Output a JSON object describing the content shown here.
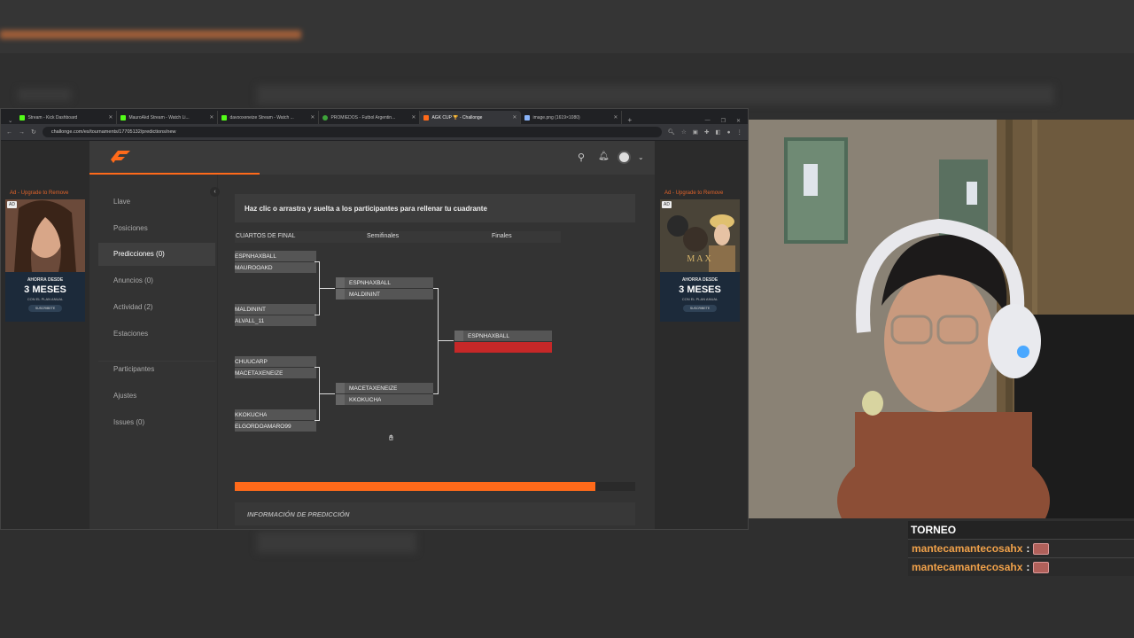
{
  "browser": {
    "tabs": [
      {
        "label": "Stream - Kick Dashboard",
        "color": "#53fc18"
      },
      {
        "label": "MauroAkd Stream - Watch Li...",
        "color": "#53fc18"
      },
      {
        "label": "davooxeneize Stream - Watch ...",
        "color": "#53fc18"
      },
      {
        "label": "PROMIEDOS - Futbol Argentin...",
        "color": "#3ea33a"
      },
      {
        "label": "AGK CUP 🏆 - Challonge",
        "color": "#ff6a1a"
      },
      {
        "label": "image.png (1619×1080)",
        "color": "#8ab4f8"
      }
    ],
    "url": "challonge.com/es/tournaments/17705132/predictions/new"
  },
  "sidebar": {
    "items": [
      {
        "label": "Llave"
      },
      {
        "label": "Posiciones"
      },
      {
        "label": "Predicciones (0)"
      },
      {
        "label": "Anuncios (0)"
      },
      {
        "label": "Actividad (2)"
      },
      {
        "label": "Estaciones"
      },
      {
        "label": "Participantes"
      },
      {
        "label": "Ajustes"
      },
      {
        "label": "Issues (0)"
      }
    ]
  },
  "main": {
    "instructions": "Haz clic o arrastra y suelta a los participantes para rellenar tu cuadrante",
    "rounds": [
      "CUARTOS DE FINAL",
      "Semifinales",
      "Finales"
    ],
    "quarterfinals": [
      [
        "ESPNHAXBALL",
        "MAUROOAKD"
      ],
      [
        "MALDININT",
        "ALVALL_11"
      ],
      [
        "CHUUCARP",
        "MACETAXENEIZE"
      ],
      [
        "KKOKUCHA",
        "ELGORDOAMARO99"
      ]
    ],
    "semifinals": [
      [
        "ESPNHAXBALL",
        "MALDININT"
      ],
      [
        "MACETAXENEIZE",
        "KKOKUCHA"
      ]
    ],
    "final": [
      "ESPNHAXBALL",
      ""
    ],
    "progress_fraction": 0.9,
    "info_title": "INFORMACIÓN DE PREDICCIÓN"
  },
  "ads": {
    "label": "Ad - Upgrade to Remove",
    "badge": "AD",
    "headline_small": "AHORRA DESDE",
    "headline_big": "3 MESES",
    "plan": "CON EL PLAN ANUAL",
    "cta": "SUSCRIBETE",
    "brand": "MAX"
  },
  "chat": {
    "title": "TORNEO",
    "messages": [
      {
        "user": "mantecamantecosahx",
        "sep": ":"
      },
      {
        "user": "mantecamantecosahx",
        "sep": ":"
      }
    ]
  },
  "colors": {
    "accent": "#ff6a1a",
    "chat_user": "#f0a14a"
  }
}
